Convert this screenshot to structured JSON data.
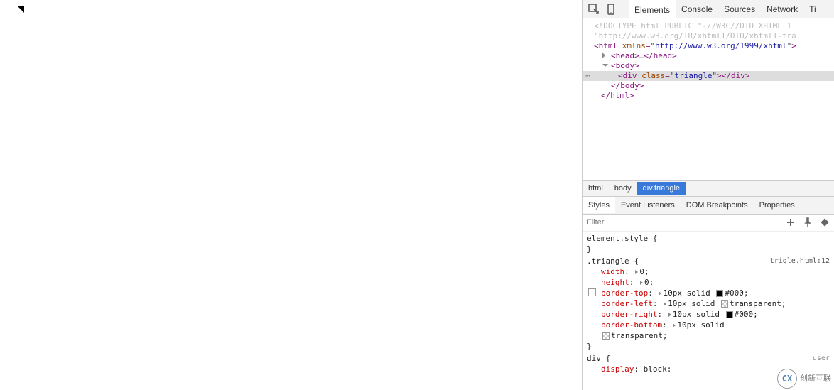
{
  "toolbar": {
    "tabs": [
      "Elements",
      "Console",
      "Sources",
      "Network",
      "Ti"
    ]
  },
  "dom": {
    "doctype": "<!DOCTYPE html PUBLIC \"-//W3C//DTD XHTML 1.",
    "doctype2": "\"http://www.w3.org/TR/xhtml1/DTD/xhtml1-tra",
    "xmlns_attr": "xmlns",
    "xmlns_val": "http://www.w3.org/1999/xhtml",
    "head_tag": "head",
    "body_tag": "body",
    "div_tag": "div",
    "class_attr": "class",
    "class_val": "triangle",
    "html_tag": "html"
  },
  "breadcrumb": [
    "html",
    "body",
    "div.triangle"
  ],
  "styles_tabs": [
    "Styles",
    "Event Listeners",
    "DOM Breakpoints",
    "Properties"
  ],
  "filter_placeholder": "Filter",
  "element_style": {
    "selector": "element.style {",
    "close": "}"
  },
  "triangle_rule": {
    "selector": ".triangle {",
    "source": "trigle.html:12",
    "props": [
      {
        "name": "width",
        "val": "0;"
      },
      {
        "name": "height",
        "val": "0;"
      },
      {
        "name": "border-top",
        "val": "10px solid",
        "color": "#000;",
        "strike": true,
        "swatch": "black",
        "chk": true
      },
      {
        "name": "border-left",
        "val": "10px solid",
        "color": "transparent;",
        "swatch": "trans"
      },
      {
        "name": "border-right",
        "val": "10px solid",
        "color": "#000;",
        "swatch": "black"
      },
      {
        "name": "border-bottom",
        "val": "10px solid",
        "color": "",
        "swatch": ""
      },
      {
        "name": "",
        "val": "",
        "color": "transparent;",
        "swatch": "trans",
        "cont": true
      }
    ],
    "close": "}"
  },
  "div_rule": {
    "selector": "div {",
    "ua": "user",
    "prop_display": "display",
    "prop_display_val": "block:"
  },
  "watermark": "创新互联"
}
